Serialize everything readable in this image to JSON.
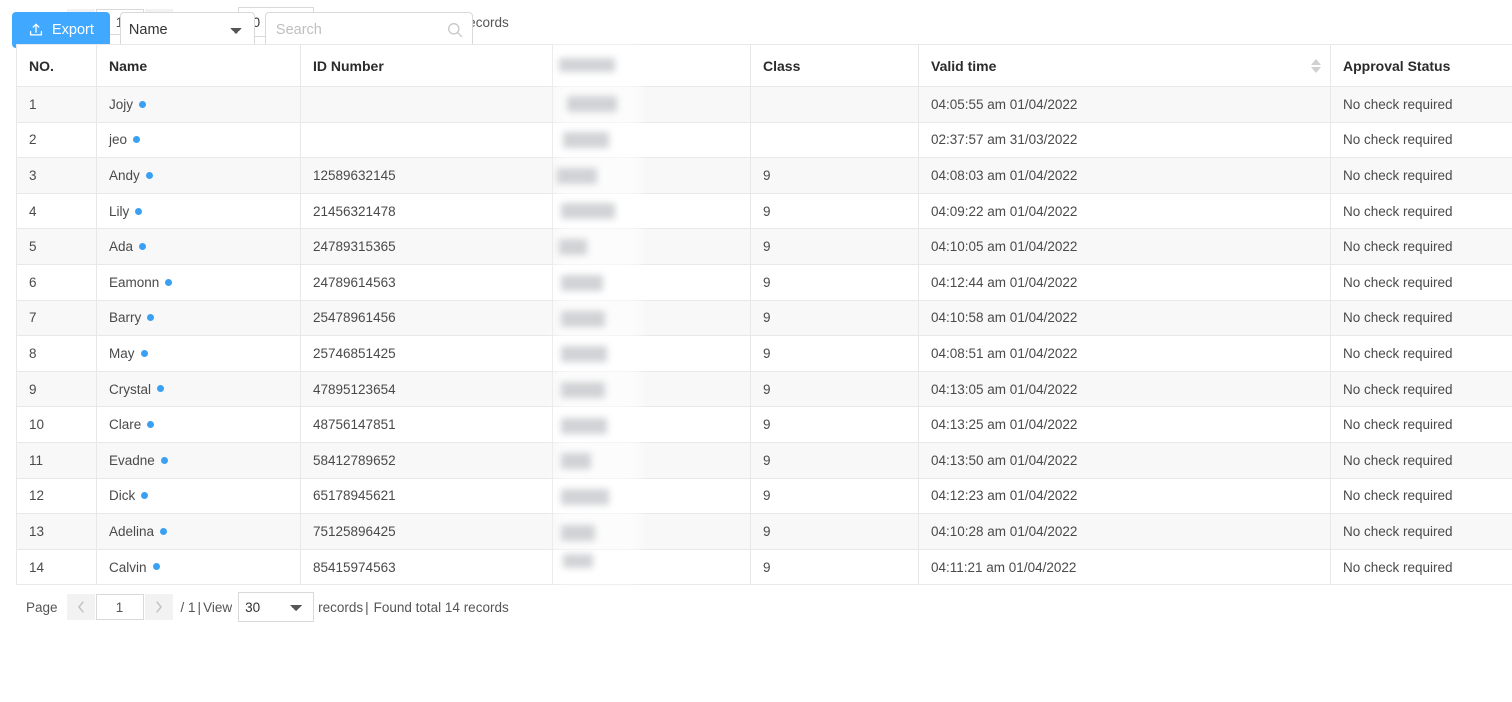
{
  "toolbar": {
    "export_label": "Export",
    "export_icon": "upload-icon",
    "field_selected": "Name",
    "field_options": [
      "Name"
    ],
    "search_placeholder": "Search",
    "search_value": "",
    "search_icon": "search-icon"
  },
  "pager": {
    "page_label": "Page",
    "prev_icon": "chevron-left-icon",
    "next_icon": "chevron-right-icon",
    "page_value": "1",
    "total_pages_label": "/ 1",
    "separator": "|",
    "view_label": "View",
    "view_selected": "30",
    "view_options": [
      "30"
    ],
    "records_label": "records",
    "found_label": "Found total 14 records"
  },
  "table": {
    "columns": [
      {
        "key": "no",
        "label": "NO."
      },
      {
        "key": "name",
        "label": "Name"
      },
      {
        "key": "id",
        "label": "ID Number"
      },
      {
        "key": "redact",
        "label": ""
      },
      {
        "key": "class",
        "label": "Class"
      },
      {
        "key": "time",
        "label": "Valid time",
        "sortable": true,
        "sort_icon": "sort-arrows-icon"
      },
      {
        "key": "status",
        "label": "Approval Status"
      }
    ],
    "rows": [
      {
        "no": "1",
        "name": "Jojy",
        "id": "",
        "class": "",
        "time": "04:05:55 am 01/04/2022",
        "status": "No check required"
      },
      {
        "no": "2",
        "name": "jeo",
        "id": "",
        "class": "",
        "time": "02:37:57 am 31/03/2022",
        "status": "No check required"
      },
      {
        "no": "3",
        "name": "Andy",
        "id": "12589632145",
        "class": "9",
        "time": "04:08:03 am 01/04/2022",
        "status": "No check required"
      },
      {
        "no": "4",
        "name": "Lily",
        "id": "21456321478",
        "class": "9",
        "time": "04:09:22 am 01/04/2022",
        "status": "No check required"
      },
      {
        "no": "5",
        "name": "Ada",
        "id": "24789315365",
        "class": "9",
        "time": "04:10:05 am 01/04/2022",
        "status": "No check required"
      },
      {
        "no": "6",
        "name": "Eamonn",
        "id": "24789614563",
        "class": "9",
        "time": "04:12:44 am 01/04/2022",
        "status": "No check required"
      },
      {
        "no": "7",
        "name": "Barry",
        "id": "25478961456",
        "class": "9",
        "time": "04:10:58 am 01/04/2022",
        "status": "No check required"
      },
      {
        "no": "8",
        "name": "May",
        "id": "25746851425",
        "class": "9",
        "time": "04:08:51 am 01/04/2022",
        "status": "No check required"
      },
      {
        "no": "9",
        "name": "Crystal",
        "id": "47895123654",
        "class": "9",
        "time": "04:13:05 am 01/04/2022",
        "status": "No check required"
      },
      {
        "no": "10",
        "name": "Clare",
        "id": "48756147851",
        "class": "9",
        "time": "04:13:25 am 01/04/2022",
        "status": "No check required"
      },
      {
        "no": "11",
        "name": "Evadne",
        "id": "58412789652",
        "class": "9",
        "time": "04:13:50 am 01/04/2022",
        "status": "No check required"
      },
      {
        "no": "12",
        "name": "Dick",
        "id": "65178945621",
        "class": "9",
        "time": "04:12:23 am 01/04/2022",
        "status": "No check required"
      },
      {
        "no": "13",
        "name": "Adelina",
        "id": "75125896425",
        "class": "9",
        "time": "04:10:28 am 01/04/2022",
        "status": "No check required"
      },
      {
        "no": "14",
        "name": "Calvin",
        "id": "85415974563",
        "class": "9",
        "time": "04:11:21 am 01/04/2022",
        "status": "No check required"
      }
    ],
    "status_dot_color": "#3aa0f3"
  },
  "colors": {
    "accent": "#40a9ff",
    "border": "#e8e8e8",
    "stripe": "#f8f8f8",
    "text": "#4a4a4a"
  }
}
